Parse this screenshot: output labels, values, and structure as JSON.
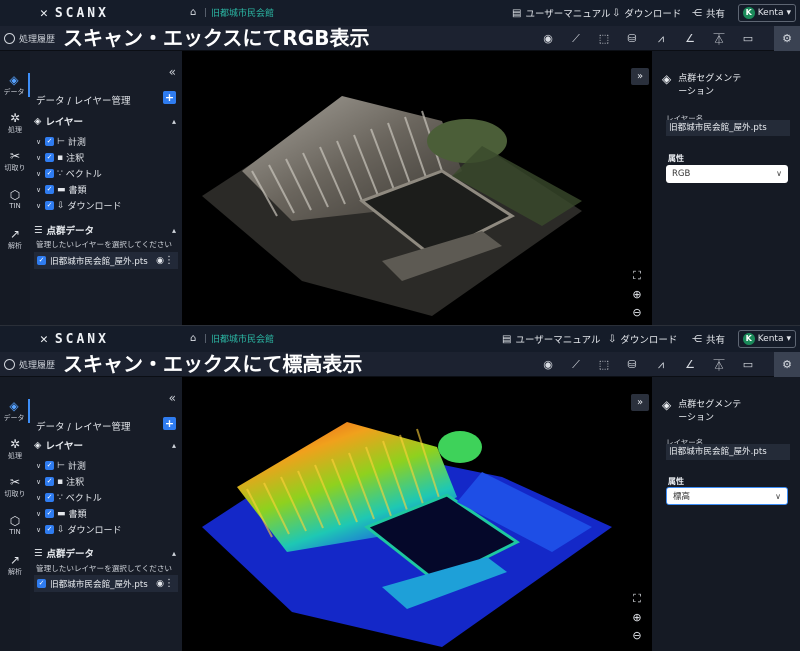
{
  "panels": [
    {
      "app": {
        "logo": "SCANX",
        "breadcrumb": "旧都城市民会館"
      },
      "nav": {
        "manual": "ユーザーマニュアル",
        "download": "ダウンロード",
        "share": "共有"
      },
      "user": {
        "initial": "K",
        "name": "Kenta"
      },
      "toolbar": {
        "history": "処理履歴",
        "caption": "スキャン・エックスにてRGB表示"
      },
      "rail": {
        "data": "データ",
        "process": "処理",
        "cut": "切取り",
        "tin": "TIN",
        "analysis": "解析"
      },
      "sidebar": {
        "title": "データ / レイヤー管理",
        "layers_heading": "レイヤー",
        "layers": [
          "計測",
          "注釈",
          "ベクトル",
          "書類",
          "ダウンロード"
        ],
        "pc_heading": "点群データ",
        "hint": "管理したいレイヤーを選択してください",
        "file": "旧都城市民会館_屋外.pts"
      },
      "right": {
        "title_line1": "点群セグメンテ",
        "title_line2": "ーション",
        "layer_label": "レイヤー名",
        "layer_value": "旧都城市民会館_屋外.pts",
        "attr_label": "属性",
        "attr_value": "RGB"
      },
      "render_mode": "rgb"
    },
    {
      "app": {
        "logo": "SCANX",
        "breadcrumb": "旧都城市民会館"
      },
      "nav": {
        "manual": "ユーザーマニュアル",
        "download": "ダウンロード",
        "share": "共有"
      },
      "user": {
        "initial": "K",
        "name": "Kenta"
      },
      "toolbar": {
        "history": "処理履歴",
        "caption": "スキャン・エックスにて標高表示"
      },
      "rail": {
        "data": "データ",
        "process": "処理",
        "cut": "切取り",
        "tin": "TIN",
        "analysis": "解析"
      },
      "sidebar": {
        "title": "データ / レイヤー管理",
        "layers_heading": "レイヤー",
        "layers": [
          "計測",
          "注釈",
          "ベクトル",
          "書類",
          "ダウンロード"
        ],
        "pc_heading": "点群データ",
        "hint": "管理したいレイヤーを選択してください",
        "file": "旧都城市民会館_屋外.pts"
      },
      "right": {
        "title_line1": "点群セグメンテ",
        "title_line2": "ーション",
        "layer_label": "レイヤー名",
        "layer_value": "旧都城市民会館_屋外.pts",
        "attr_label": "属性",
        "attr_value": "標高"
      },
      "render_mode": "elevation"
    }
  ],
  "tools": [
    "pin-icon",
    "measure-line-icon",
    "area-icon",
    "volume-icon",
    "profile-chart-icon",
    "angle-icon",
    "height-icon",
    "comment-icon",
    "settings-icon"
  ]
}
